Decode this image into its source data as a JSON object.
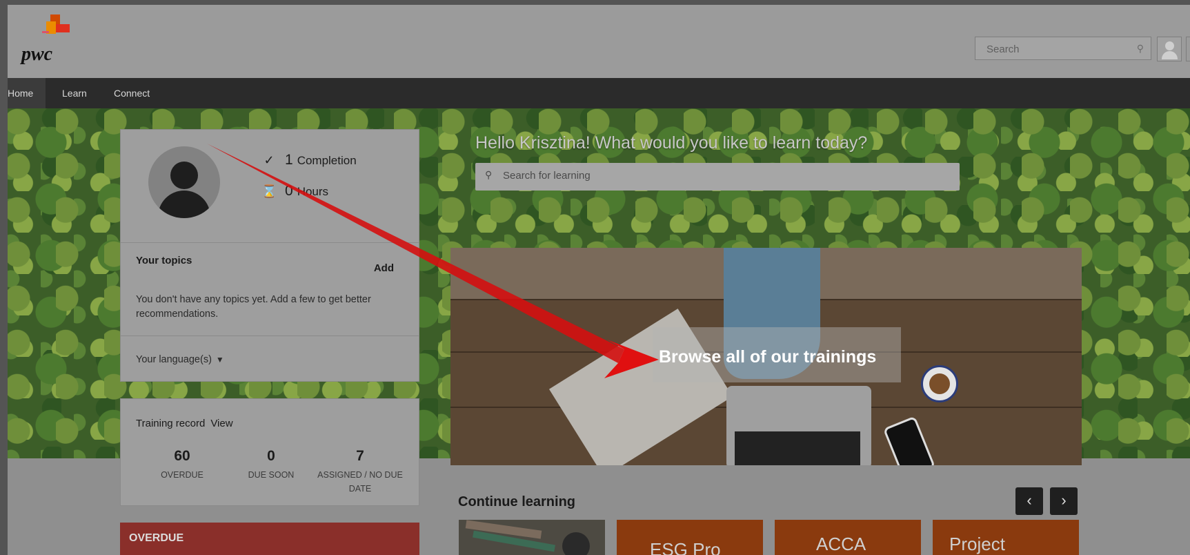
{
  "header": {
    "logo_text": "pwc",
    "search_placeholder": "Search"
  },
  "nav": {
    "items": [
      {
        "label": "Home"
      },
      {
        "label": "Learn"
      },
      {
        "label": "Connect"
      }
    ]
  },
  "profile": {
    "completion_count": "1",
    "completion_label": "Completion",
    "hours_count": "0",
    "hours_label": "Hours",
    "topics_title": "Your topics",
    "topics_add": "Add",
    "topics_text": "You don't have any topics yet. Add a few to get better recommendations.",
    "language_label": "Your language(s)"
  },
  "training_record": {
    "title": "Training record",
    "view_label": "View",
    "stats": [
      {
        "value": "60",
        "label": "OVERDUE"
      },
      {
        "value": "0",
        "label": "DUE SOON"
      },
      {
        "value": "7",
        "label": "ASSIGNED / NO DUE DATE"
      }
    ]
  },
  "overdue": {
    "label": "OVERDUE"
  },
  "hero": {
    "greeting": "Hello Krisztina! What would you like to learn today?",
    "search_placeholder": "Search for learning",
    "banner_label": "Browse all of our trainings"
  },
  "continue_learning": {
    "title": "Continue learning",
    "tiles": [
      {
        "label": ""
      },
      {
        "label": "ESG Pro"
      },
      {
        "label": "ACCA"
      },
      {
        "label": "Project"
      }
    ]
  },
  "colors": {
    "nav_bg": "#2b2b2b",
    "overdue_red": "#8a2f2a",
    "tile_orange": "#8a3a0e",
    "annotation_arrow": "#d40f0f"
  },
  "icons": [
    "search-icon",
    "user-icon",
    "check-circle-icon",
    "hourglass-icon",
    "caret-down-icon",
    "chevron-left-icon",
    "chevron-right-icon"
  ]
}
